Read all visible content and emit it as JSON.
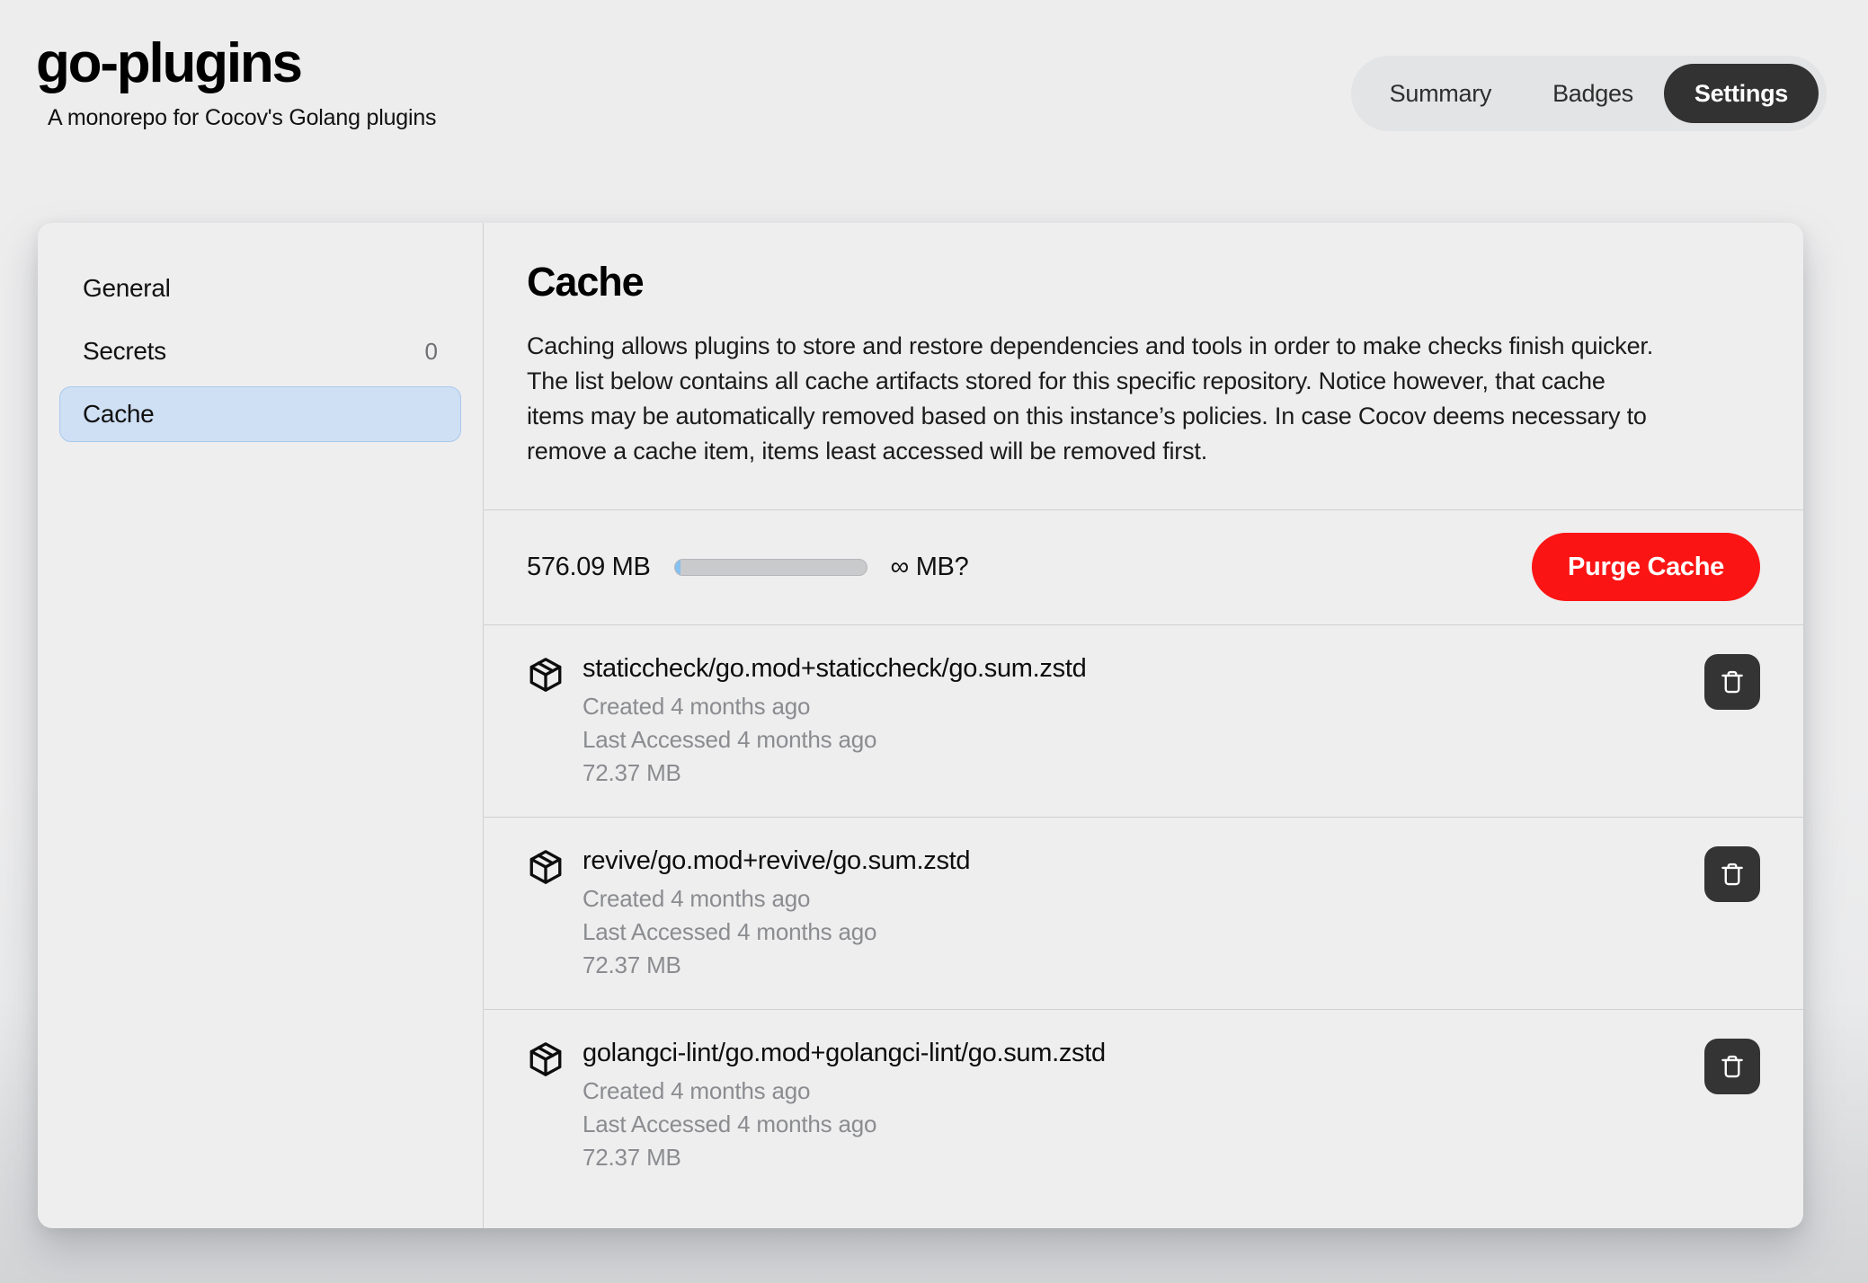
{
  "header": {
    "repo_title": "go-plugins",
    "repo_subtitle": "A monorepo for Cocov's Golang plugins",
    "tabs": [
      {
        "label": "Summary",
        "active": false
      },
      {
        "label": "Badges",
        "active": false
      },
      {
        "label": "Settings",
        "active": true
      }
    ]
  },
  "sidebar": {
    "items": [
      {
        "label": "General",
        "count": "",
        "active": false
      },
      {
        "label": "Secrets",
        "count": "0",
        "active": false
      },
      {
        "label": "Cache",
        "count": "",
        "active": true
      }
    ]
  },
  "content": {
    "title": "Cache",
    "description": "Caching allows plugins to store and restore dependencies and tools in order to make checks finish quicker. The list below contains all cache artifacts stored for this specific repository. Notice however, that cache items may be automatically removed based on this instance’s policies. In case Cocov deems necessary to remove a cache item, items least accessed will be removed first."
  },
  "usage": {
    "used_label": "576.09 MB",
    "max_label": "∞ MB?",
    "percent": 3,
    "purge_label": "Purge Cache"
  },
  "cache_items": [
    {
      "name": "staticcheck/go.mod+staticcheck/go.sum.zstd",
      "created": "Created 4 months ago",
      "last_accessed": "Last Accessed 4 months ago",
      "size": "72.37 MB"
    },
    {
      "name": "revive/go.mod+revive/go.sum.zstd",
      "created": "Created 4 months ago",
      "last_accessed": "Last Accessed 4 months ago",
      "size": "72.37 MB"
    },
    {
      "name": "golangci-lint/go.mod+golangci-lint/go.sum.zstd",
      "created": "Created 4 months ago",
      "last_accessed": "Last Accessed 4 months ago",
      "size": "72.37 MB"
    }
  ],
  "colors": {
    "page_background": "#ededee",
    "card_background": "#eeeeef",
    "accent_danger": "#fb1414",
    "active_tab": "#323232",
    "sidebar_active_bg": "#cfe0f4",
    "sidebar_active_border": "#a9c9ec",
    "progress_fill": "#86c0ef",
    "divider": "#cfd0d2",
    "muted_text": "#8b8c8f"
  },
  "icons": {
    "package": "package-icon",
    "delete": "trash-icon"
  }
}
